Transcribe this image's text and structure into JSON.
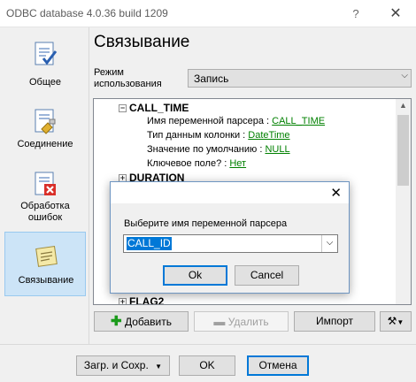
{
  "window": {
    "title": "ODBC database 4.0.36 build 1209",
    "help_glyph": "?",
    "close_glyph": "✕"
  },
  "sidebar": {
    "items": [
      {
        "label": "Общее",
        "icon": "general-doc-icon"
      },
      {
        "label": "Соединение",
        "icon": "connection-icon"
      },
      {
        "label": "Обработка ошибок",
        "icon": "error-handling-icon"
      },
      {
        "label": "Связывание",
        "icon": "binding-icon",
        "active": true
      }
    ]
  },
  "main": {
    "page_title": "Связывание",
    "mode_label": "Режим использования",
    "mode_value": "Запись",
    "tree": {
      "group1": "CALL_TIME",
      "rows": [
        {
          "key": "Имя переменной парсера : ",
          "value": "CALL_TIME"
        },
        {
          "key": "Тип данным колонки : ",
          "value": "DateTime"
        },
        {
          "key": "Значение по умолчанию : ",
          "value": "NULL"
        },
        {
          "key": "Ключевое поле? : ",
          "value": "Нет"
        }
      ],
      "group2": "DURATION",
      "group3": "FLAG2"
    },
    "buttons": {
      "add": "Добавить",
      "delete": "Удалить",
      "import": "Импорт"
    }
  },
  "footer": {
    "load_save": "Загр. и Сохр.",
    "ok": "OK",
    "cancel": "Отмена"
  },
  "modal": {
    "prompt": "Выберите имя переменной парсера",
    "selected": "CALL_ID",
    "ok": "Ok",
    "cancel": "Cancel"
  }
}
